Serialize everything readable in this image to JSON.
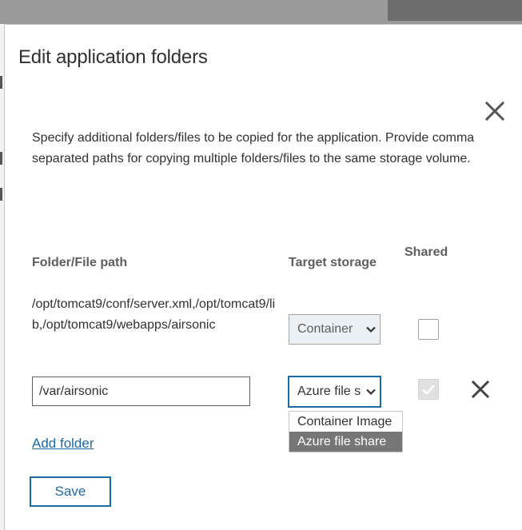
{
  "dialog": {
    "title": "Edit application folders",
    "description": "Specify additional folders/files to be copied for the application. Provide comma separated paths for copying multiple folders/files to the same storage volume.",
    "columns": {
      "path": "Folder/File path",
      "target": "Target storage",
      "shared": "Shared"
    },
    "rows": [
      {
        "path": "/opt/tomcat9/conf/server.xml,/opt/tomcat9/lib,/opt/tomcat9/webapps/airsonic",
        "target": "Container",
        "shared": false
      },
      {
        "path": "/var/airsonic",
        "target": "Azure file s",
        "shared": true
      }
    ],
    "dropdown_options": [
      "Container Image",
      "Azure file share"
    ],
    "dropdown_selected": "Azure file share",
    "add_folder_label": "Add folder",
    "save_label": "Save"
  },
  "icons": {
    "close": "close-icon",
    "remove": "remove-row-icon",
    "chevron": "chevron-down-icon",
    "check": "check-icon"
  },
  "colors": {
    "accent": "#1b6aa5",
    "selected_option_bg": "#767676",
    "backdrop": "#9a9a9a"
  }
}
